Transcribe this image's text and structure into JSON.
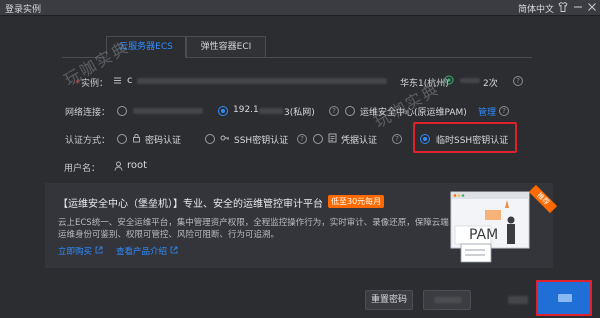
{
  "window": {
    "title": "登录实例",
    "language": "简体中文"
  },
  "tabs": [
    {
      "label": "云服务器ECS",
      "active": true
    },
    {
      "label": "弹性容器ECI",
      "active": false
    }
  ],
  "instance": {
    "label": "实例：",
    "id_prefix": "c",
    "region": "华东1(杭州)",
    "count": "2次"
  },
  "network": {
    "label": "网络连接：",
    "option_private_ip": "192.1",
    "option_private_suffix": "3(私网)",
    "option_bastion": "运维安全中心(原运维PAM)",
    "manage_link": "管理"
  },
  "auth": {
    "label": "认证方式：",
    "options": [
      {
        "label": "密码认证",
        "icon": "lock-icon",
        "selected": false
      },
      {
        "label": "SSH密钥认证",
        "icon": "key-icon",
        "selected": false
      },
      {
        "label": "凭据认证",
        "icon": "credential-icon",
        "selected": false
      },
      {
        "label": "临时SSH密钥认证",
        "icon": "",
        "selected": true
      }
    ]
  },
  "user": {
    "label": "用户名：",
    "value": "root"
  },
  "banner": {
    "title": "【运维安全中心（堡垒机）】专业、安全的运维管控审计平台",
    "badge": "低至30元每月",
    "description": "云上ECS统一、安全运维平台，集中管理资产权限，全程监控操作行为，实时审计、录像还原，保障云端运维身份可鉴别、权限可管控、风险可阻断、行为可追溯。",
    "link_buy": "立即购买",
    "link_intro": "查看产品介绍",
    "ribbon": "推荐",
    "art_text": "PAM"
  },
  "buttons": {
    "reset_password": "重置密码"
  },
  "watermark": "玩咖实典",
  "colors": {
    "accent": "#2f8cff",
    "highlight": "#e0202c",
    "badge": "#ff6a00",
    "online": "#3cb371"
  }
}
